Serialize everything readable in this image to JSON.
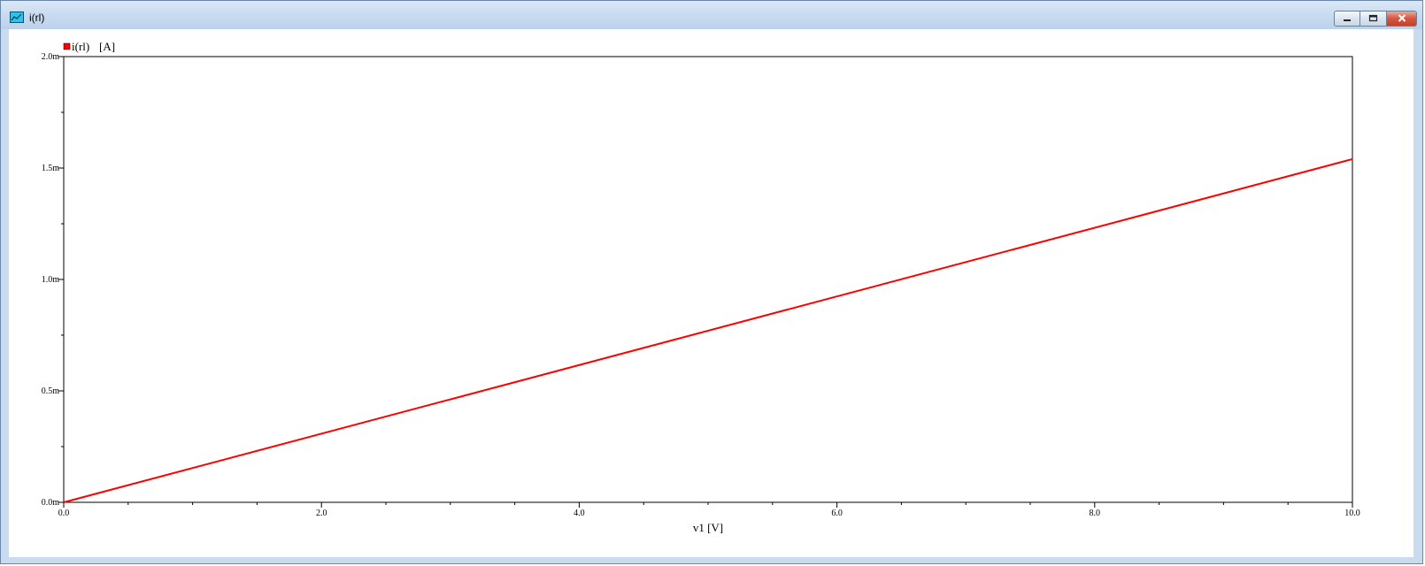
{
  "window": {
    "title": "i(rl)",
    "icon": "graph-window-icon",
    "buttons": {
      "minimize": "minimize-icon",
      "maximize": "restore-icon",
      "close": "close-icon"
    }
  },
  "chart_data": {
    "type": "line",
    "title": "",
    "xlabel": "v1 [V]",
    "ylabel": "",
    "xlim": [
      0,
      10
    ],
    "ylim": [
      0,
      0.002
    ],
    "x_ticks": [
      {
        "value": 0,
        "label": "0.0"
      },
      {
        "value": 2,
        "label": "2.0"
      },
      {
        "value": 4,
        "label": "4.0"
      },
      {
        "value": 6,
        "label": "6.0"
      },
      {
        "value": 8,
        "label": "8.0"
      },
      {
        "value": 10,
        "label": "10.0"
      }
    ],
    "y_ticks": [
      {
        "value": 0,
        "label": "0.0m"
      },
      {
        "value": 0.0005,
        "label": "0.5m"
      },
      {
        "value": 0.001,
        "label": "1.0m"
      },
      {
        "value": 0.0015,
        "label": "1.5m"
      },
      {
        "value": 0.002,
        "label": "2.0m"
      }
    ],
    "x_minor_step": 0.5,
    "y_minor_step": 0.00025,
    "grid": false,
    "legend": {
      "placement": "top-left",
      "entries": [
        {
          "name": "i(rl)",
          "unit": "[A]",
          "color": "#ff0000"
        }
      ]
    },
    "series": [
      {
        "name": "i(rl)",
        "color": "#ff0000",
        "x": [
          0,
          10
        ],
        "y": [
          0,
          0.00154
        ]
      }
    ]
  }
}
